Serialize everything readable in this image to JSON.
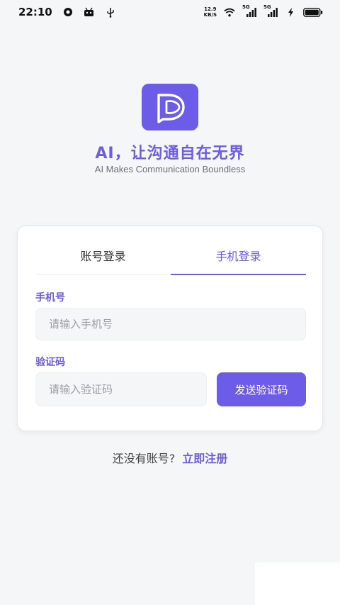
{
  "status_bar": {
    "time": "22:10",
    "left_icons": [
      "circle-app-icon",
      "android-icon",
      "usb-icon"
    ],
    "net_speed_value": "12.9",
    "net_speed_unit": "KB/S",
    "sim1_label": "5G",
    "sim2_label": "5G",
    "right_icons": [
      "wifi-icon",
      "signal-icon",
      "signal-icon",
      "charging-icon",
      "battery-icon"
    ]
  },
  "app": {
    "logo_icon": "app-logo-icon",
    "title": "AI，让沟通自在无界",
    "subtitle": "AI Makes Communication Boundless",
    "accent_color": "#6c5ce7"
  },
  "login": {
    "tabs": [
      {
        "label": "账号登录",
        "active": false
      },
      {
        "label": "手机登录",
        "active": true
      }
    ],
    "phone_label": "手机号",
    "phone_placeholder": "请输入手机号",
    "code_label": "验证码",
    "code_placeholder": "请输入验证码",
    "send_code_button": "发送验证码"
  },
  "footer": {
    "prompt": "还没有账号?",
    "register_link": "立即注册"
  }
}
